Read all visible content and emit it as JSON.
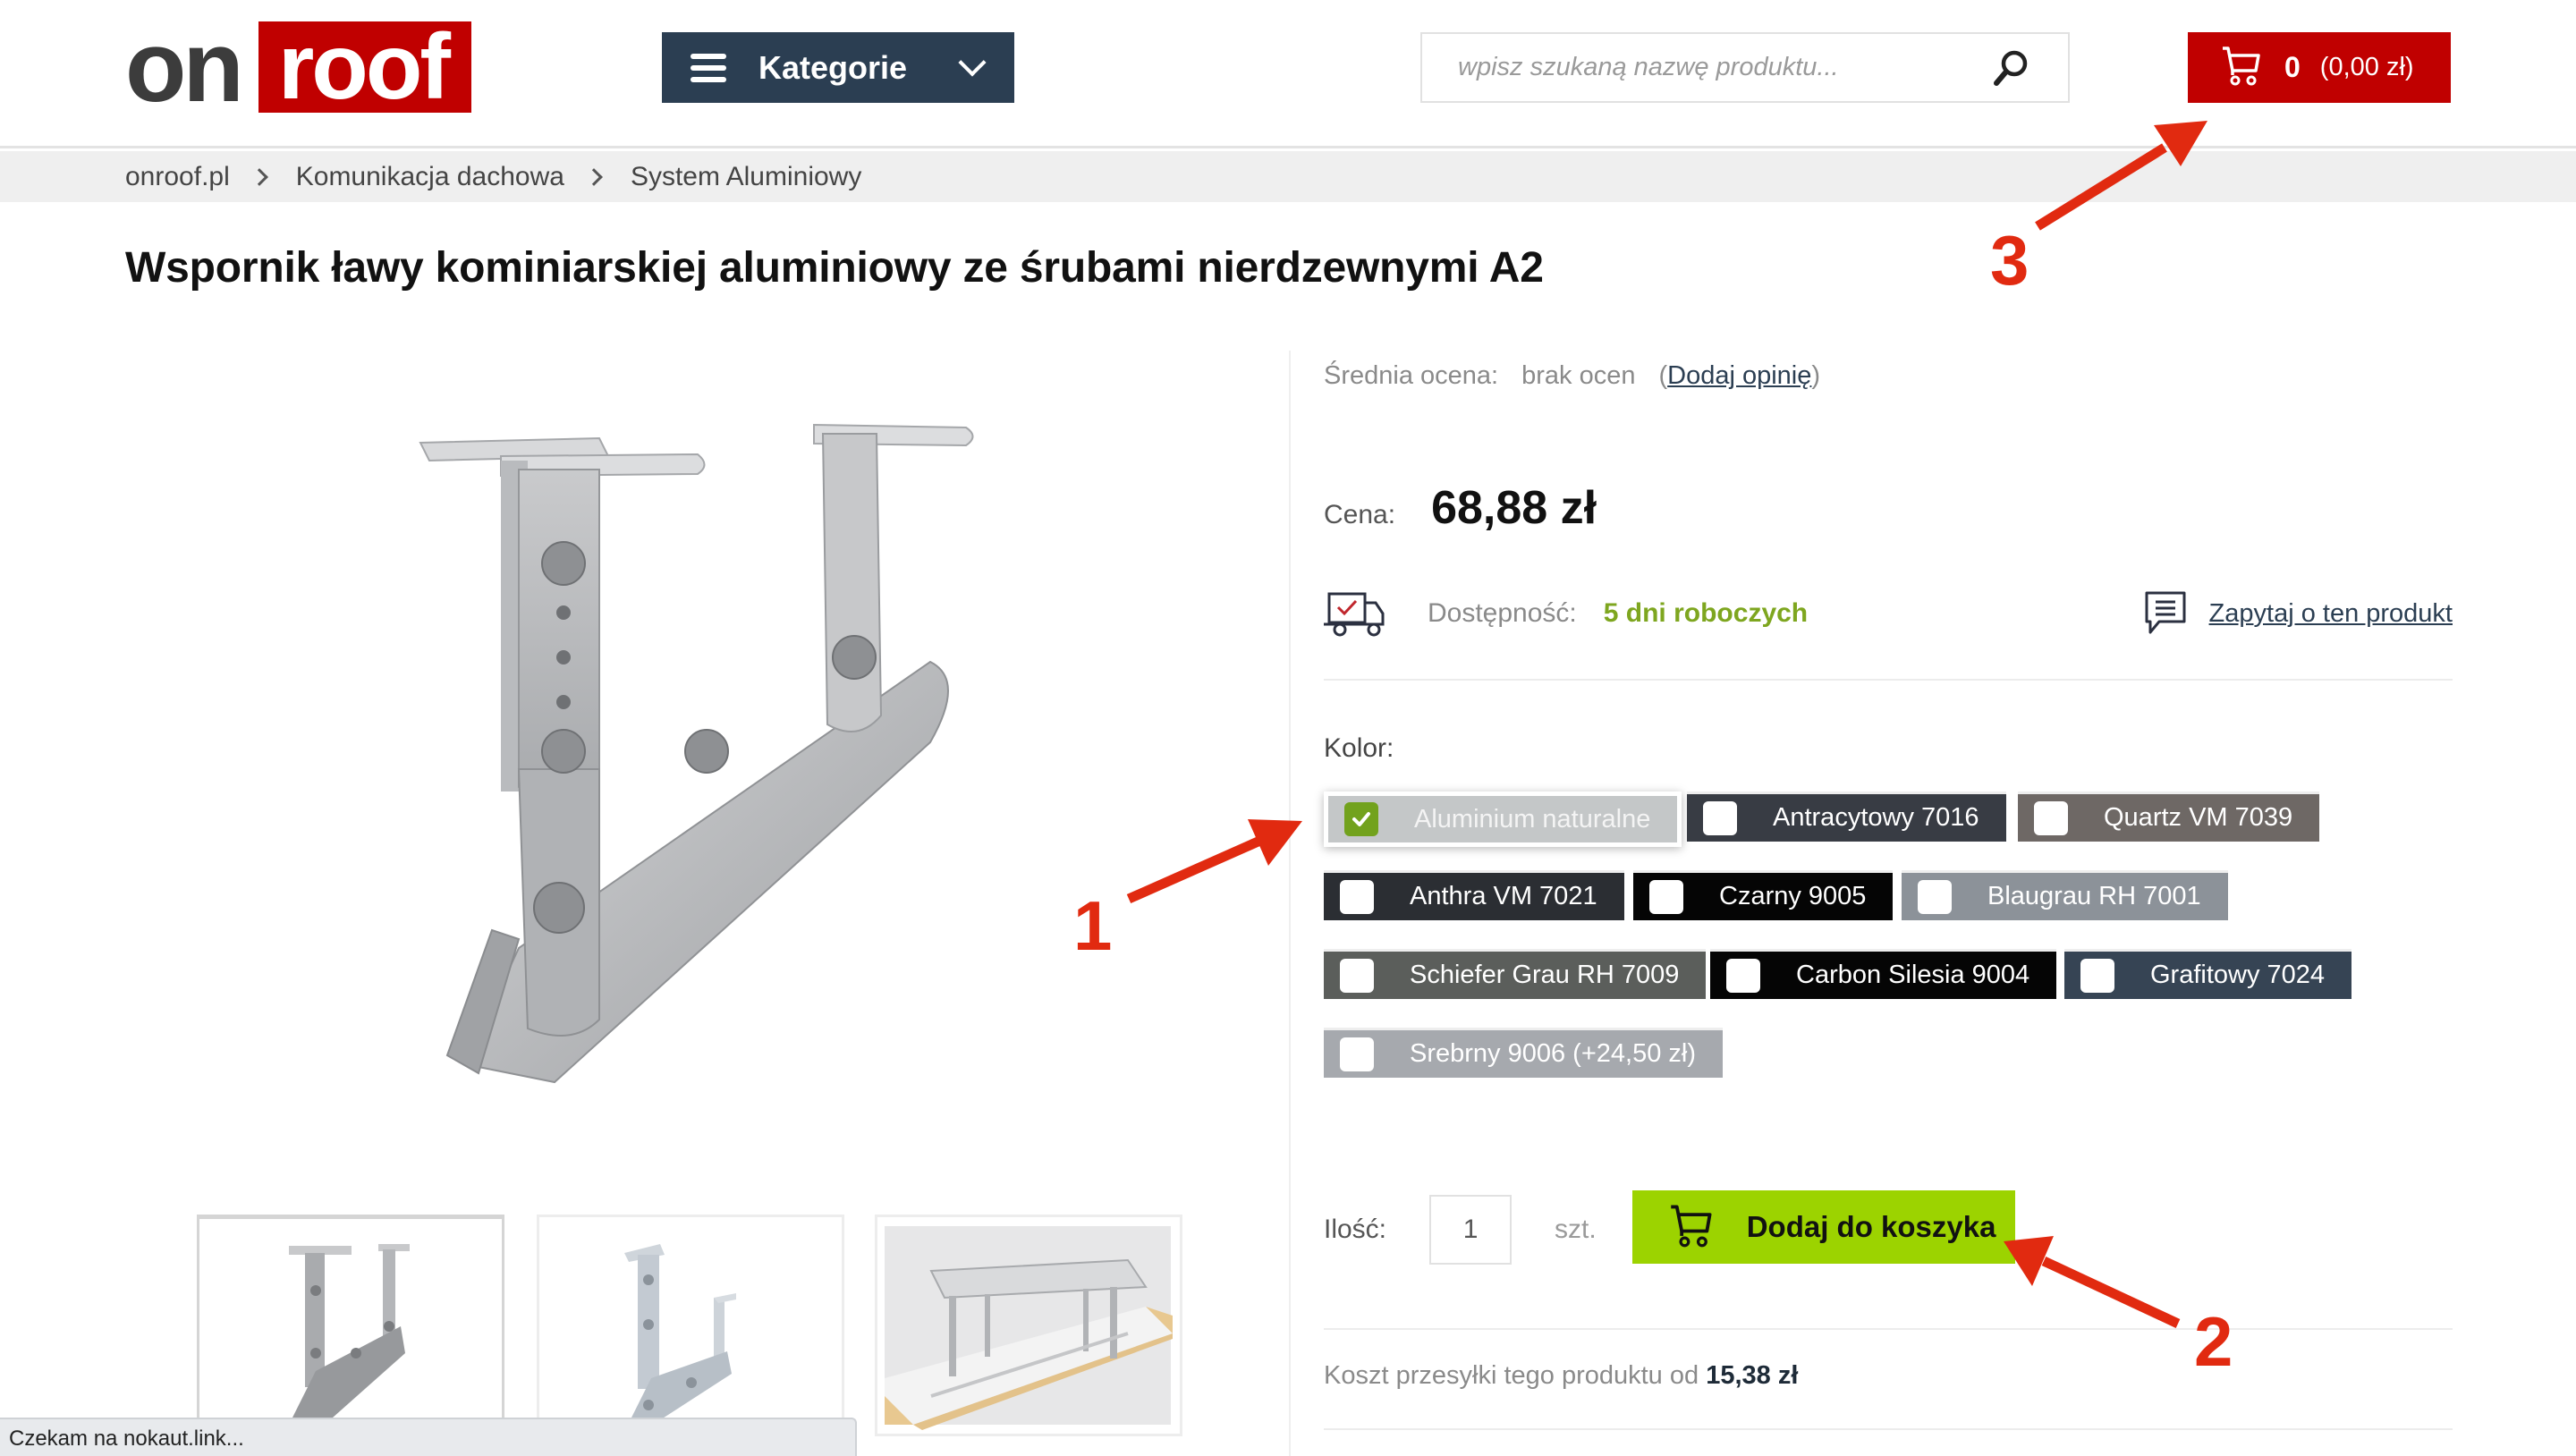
{
  "header": {
    "logo": {
      "part1": "on",
      "part2": "roof"
    },
    "categories_label": "Kategorie",
    "search": {
      "placeholder": "wpisz szukaną nazwę produktu...",
      "value": ""
    },
    "cart": {
      "count": "0",
      "total": "(0,00 zł)"
    }
  },
  "breadcrumb": [
    "onroof.pl",
    "Komunikacja dachowa",
    "System Aluminiowy"
  ],
  "product": {
    "title": "Wspornik ławy kominiarskiej aluminiowy ze śrubami nierdzewnymi A2",
    "rating": {
      "label": "Średnia ocena:",
      "value": "brak ocen",
      "add_open": "(",
      "add_link": "Dodaj opinię",
      "add_close": ")"
    },
    "price": {
      "label": "Cena:",
      "value": "68,88 zł"
    },
    "availability": {
      "label": "Dostępność:",
      "value": "5 dni roboczych"
    },
    "ask_link": "Zapytaj o ten produkt",
    "color": {
      "label": "Kolor:",
      "selected": "Aluminium naturalne",
      "options": [
        {
          "label": "Aluminium naturalne",
          "bg": "#c4c7c8",
          "selected": true
        },
        {
          "label": "Antracytowy 7016",
          "bg": "#383c44",
          "selected": false
        },
        {
          "label": "Quartz VM 7039",
          "bg": "#6e6865",
          "selected": false
        },
        {
          "label": "Anthra VM 7021",
          "bg": "#2b2e33",
          "selected": false
        },
        {
          "label": "Czarny 9005",
          "bg": "#050505",
          "selected": false
        },
        {
          "label": "Blaugrau RH 7001",
          "bg": "#8c9299",
          "selected": false
        },
        {
          "label": "Schiefer Grau RH 7009",
          "bg": "#5b5e5b",
          "selected": false
        },
        {
          "label": "Carbon Silesia 9004",
          "bg": "#050505",
          "selected": false
        },
        {
          "label": "Grafitowy 7024",
          "bg": "#364454",
          "selected": false
        },
        {
          "label": "Srebrny 9006 (+24,50 zł)",
          "bg": "#a6a9ae",
          "selected": false
        }
      ]
    },
    "quantity": {
      "label": "Ilość:",
      "value": "1",
      "unit": "szt."
    },
    "add_to_cart": "Dodaj do koszyka",
    "shipping": {
      "text": "Koszt przesyłki tego produktu od",
      "value": "15,38 zł"
    },
    "thumbnails": [
      "bracket-aluminium-grey",
      "bracket-galvanized",
      "walkway-installed-on-roof"
    ]
  },
  "annotations": [
    "1",
    "2",
    "3"
  ],
  "status_bar": "Czekam na nokaut.link...",
  "colors": {
    "brand_red": "#c00000",
    "nav_dark": "#2b3e52",
    "cta_green": "#9cd300",
    "availability_green": "#7ea61f",
    "annotation_red": "#e12a10"
  }
}
